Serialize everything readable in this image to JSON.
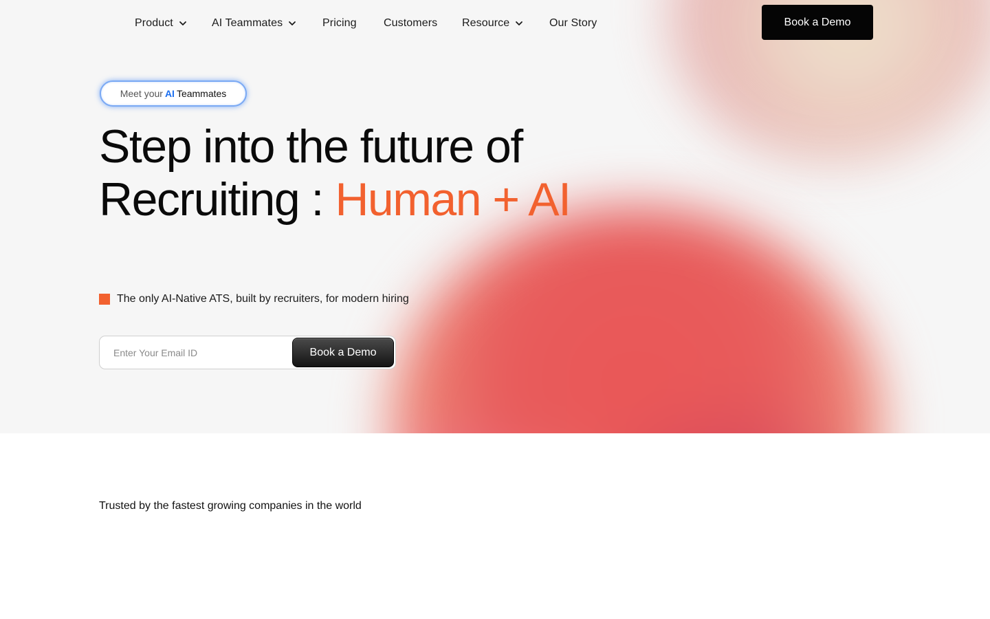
{
  "nav": {
    "items": [
      {
        "label": "Product",
        "dropdown": true
      },
      {
        "label": "AI Teammates",
        "dropdown": true
      },
      {
        "label": "Pricing",
        "dropdown": false
      },
      {
        "label": "Customers",
        "dropdown": false
      },
      {
        "label": "Resource",
        "dropdown": true
      },
      {
        "label": "Our Story",
        "dropdown": false
      }
    ],
    "cta_label": "Book a Demo"
  },
  "hero": {
    "pill": {
      "prefix": "Meet your",
      "highlight": "AI",
      "suffix": "Teammates"
    },
    "headline": {
      "line1": "Step into the future of",
      "line2": "Recruiting :",
      "accent": "Human + AI"
    },
    "tagline": "The only AI-Native ATS, built by recruiters, for modern hiring",
    "email_placeholder": "Enter Your Email ID",
    "email_value": "",
    "form_button": "Book a Demo"
  },
  "trusted": {
    "text": "Trusted by the fastest growing companies in the world"
  },
  "colors": {
    "accent": "#f2612f",
    "ai_blue": "#1b6ff0",
    "cta_black": "#050505",
    "hero_bg": "#f6f6f6"
  }
}
